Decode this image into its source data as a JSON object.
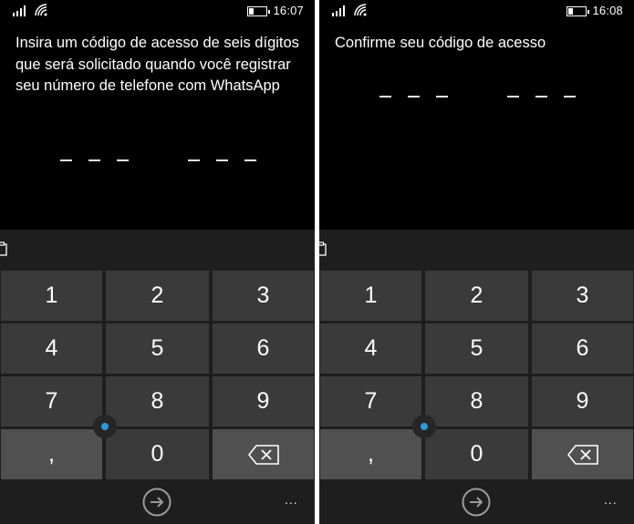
{
  "screens": [
    {
      "status": {
        "time": "16:07",
        "battery_level": 0.25
      },
      "prompt": "Insira um código de acesso de seis dígitos que será solicitado quando você registrar seu número de telefone com WhatsApp",
      "keys": [
        "1",
        "2",
        "3",
        "4",
        "5",
        "6",
        "7",
        "8",
        "9",
        ",",
        "0"
      ],
      "more_label": "..."
    },
    {
      "status": {
        "time": "16:08",
        "battery_level": 0.25
      },
      "prompt": "Confirme seu código de acesso",
      "keys": [
        "1",
        "2",
        "3",
        "4",
        "5",
        "6",
        "7",
        "8",
        "9",
        ",",
        "0"
      ],
      "more_label": "..."
    }
  ],
  "icons": {
    "signal": "signal-icon",
    "wifi": "wifi-icon",
    "battery": "battery-icon",
    "clipboard": "clipboard-icon",
    "backspace": "backspace-icon",
    "enter": "arrow-right-circle-icon",
    "cursor": "text-cursor-icon"
  },
  "colors": {
    "background": "#000000",
    "key": "#3a3a3a",
    "function_key": "#505050",
    "cursor_accent": "#2d9bd9"
  }
}
